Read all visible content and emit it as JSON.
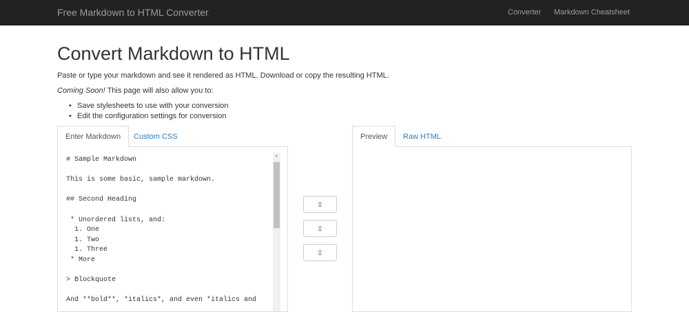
{
  "navbar": {
    "brand": "Free Markdown to HTML Converter",
    "links": [
      "Converter",
      "Markdown Cheatsheet"
    ]
  },
  "page": {
    "title": "Convert Markdown to HTML",
    "intro": "Paste or type your markdown and see it rendered as HTML. Download or copy the resulting HTML.",
    "coming_soon_label": "Coming Soon!",
    "coming_soon_text": " This page will also allow you to:",
    "features": [
      "Save stylesheets to use with your conversion",
      "Edit the configuration settings for conversion"
    ]
  },
  "editor": {
    "tabs": [
      "Enter Markdown",
      "Custom CSS"
    ],
    "content": "# Sample Markdown\n\nThis is some basic, sample markdown.\n\n## Second Heading\n\n * Unordered lists, and:\n  1. One\n  1. Two\n  1. Three\n * More\n\n> Blockquote\n\nAnd **bold**, *italics*, and even *italics and"
  },
  "preview": {
    "tabs": [
      "Preview",
      "Raw HTML"
    ]
  },
  "actions": {
    "buttons": [
      "▯",
      "▯",
      "▯"
    ]
  }
}
